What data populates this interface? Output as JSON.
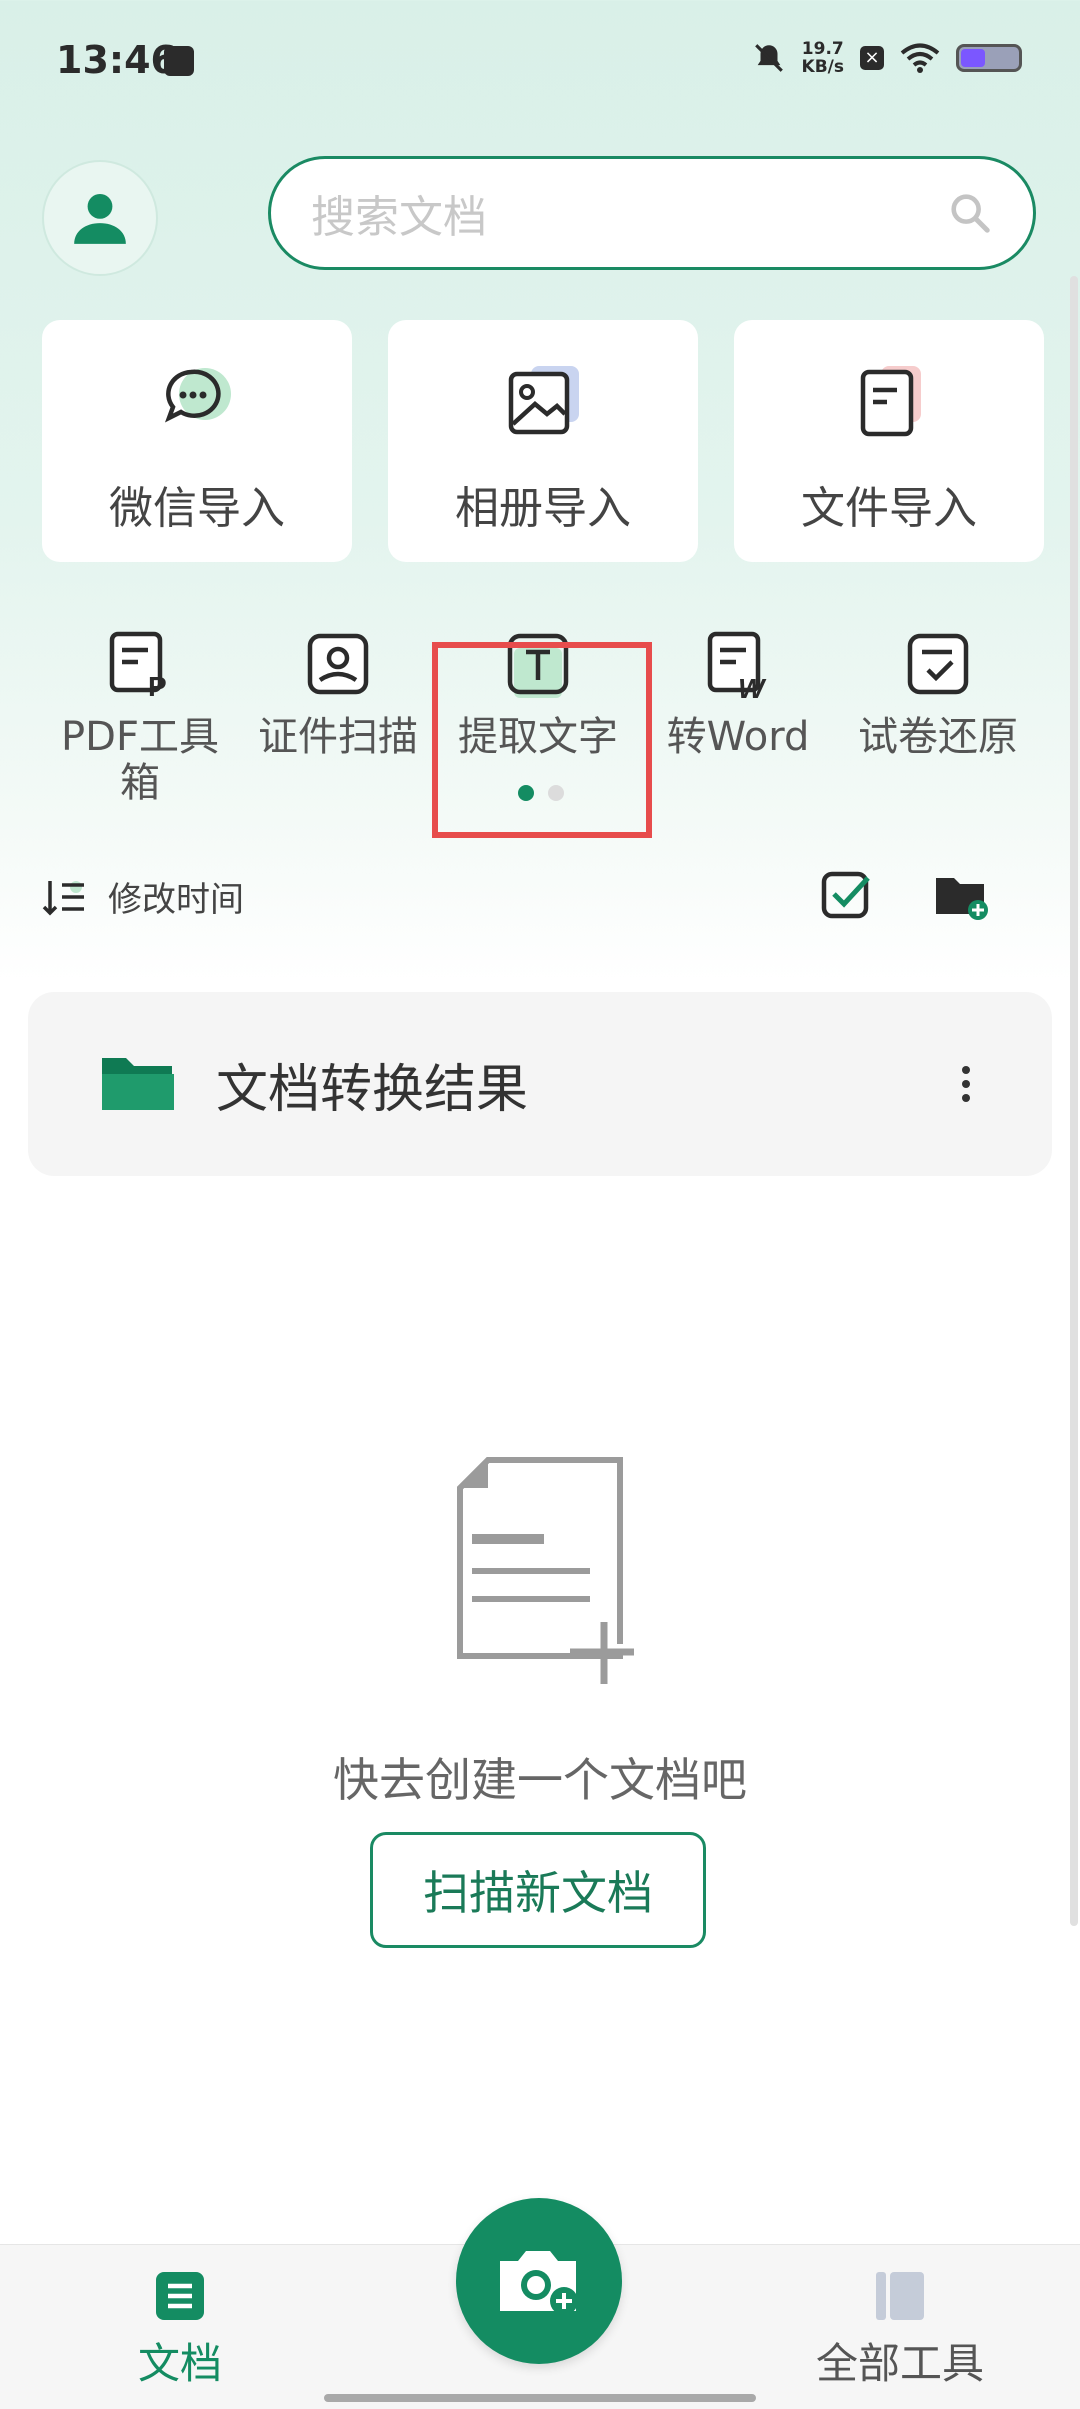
{
  "status_bar": {
    "time": "13:46",
    "speed_value": "19.7",
    "speed_unit": "KB/s",
    "icons": [
      "app-notification-icon",
      "mute-icon",
      "sim-off-icon",
      "wifi-icon",
      "battery-icon"
    ]
  },
  "header": {
    "search_placeholder": "搜索文档"
  },
  "import_cards": [
    {
      "label": "微信导入",
      "icon": "wechat-icon"
    },
    {
      "label": "相册导入",
      "icon": "album-icon"
    },
    {
      "label": "文件导入",
      "icon": "file-icon"
    }
  ],
  "tools": [
    {
      "label": "PDF工具箱",
      "icon": "pdf-tools-icon"
    },
    {
      "label": "证件扫描",
      "icon": "id-scan-icon"
    },
    {
      "label": "提取文字",
      "icon": "extract-text-icon"
    },
    {
      "label": "转Word",
      "icon": "to-word-icon"
    },
    {
      "label": "试卷还原",
      "icon": "exam-restore-icon"
    }
  ],
  "sort": {
    "label": "修改时间"
  },
  "folder": {
    "name": "文档转换结果"
  },
  "empty_state": {
    "text": "快去创建一个文档吧",
    "button": "扫描新文档"
  },
  "bottom_nav": {
    "docs": "文档",
    "all_tools": "全部工具"
  },
  "colors": {
    "accent": "#148c62",
    "highlight": "#e74c4c"
  }
}
